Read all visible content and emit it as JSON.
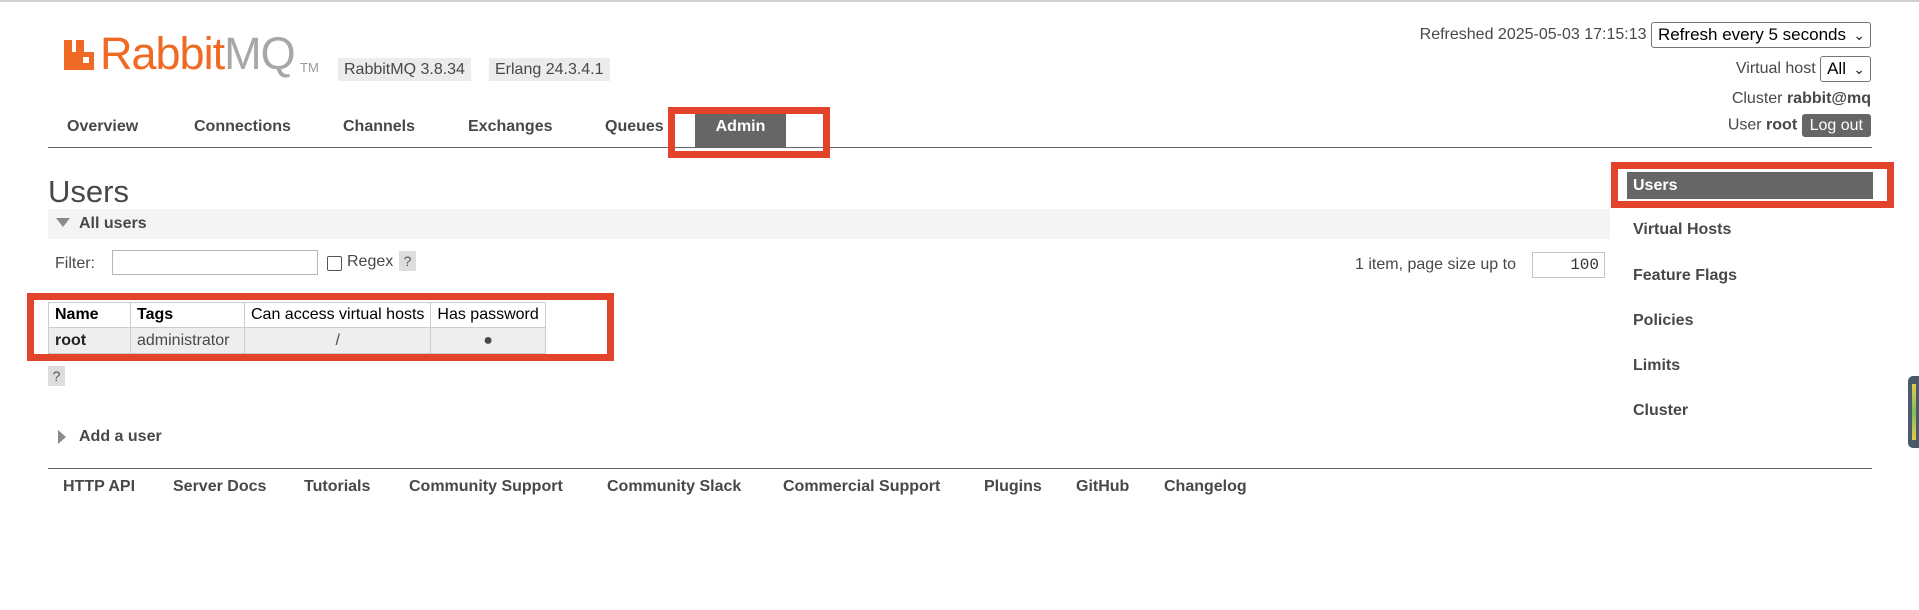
{
  "app": {
    "logo_rabbit": "Rabbit",
    "logo_mq": "MQ",
    "logo_tm": "TM",
    "version": "RabbitMQ 3.8.34",
    "erlang": "Erlang 24.3.4.1"
  },
  "status": {
    "refreshed_label": "Refreshed 2025-05-03 17:15:13",
    "refresh_select": "Refresh every 5 seconds",
    "vhost_label": "Virtual host",
    "vhost_select": "All",
    "cluster_label": "Cluster",
    "cluster_name": "rabbit@mq",
    "user_label": "User",
    "user_name": "root",
    "logout": "Log out"
  },
  "tabs": [
    {
      "label": "Overview"
    },
    {
      "label": "Connections"
    },
    {
      "label": "Channels"
    },
    {
      "label": "Exchanges"
    },
    {
      "label": "Queues"
    },
    {
      "label": "Admin",
      "active": true
    }
  ],
  "main": {
    "title": "Users",
    "section": "All users",
    "filter_label": "Filter:",
    "filter_value": "",
    "regex_label": "Regex",
    "help": "?",
    "pager_text": "1 item, page size up to",
    "page_size": "100",
    "add_user": "Add a user"
  },
  "table": {
    "headers": [
      "Name",
      "Tags",
      "Can access virtual hosts",
      "Has password"
    ],
    "rows": [
      {
        "name": "root",
        "tags": "administrator",
        "vhosts": "/",
        "has_password": "●"
      }
    ]
  },
  "sidebar": {
    "items": [
      {
        "label": "Users",
        "active": true
      },
      {
        "label": "Virtual Hosts"
      },
      {
        "label": "Feature Flags"
      },
      {
        "label": "Policies"
      },
      {
        "label": "Limits"
      },
      {
        "label": "Cluster"
      }
    ]
  },
  "footer": {
    "links": [
      "HTTP API",
      "Server Docs",
      "Tutorials",
      "Community Support",
      "Community Slack",
      "Commercial Support",
      "Plugins",
      "GitHub",
      "Changelog"
    ]
  },
  "colors": {
    "brand": "#f06a23",
    "highlight": "#e2432a",
    "active_tab": "#666666"
  }
}
